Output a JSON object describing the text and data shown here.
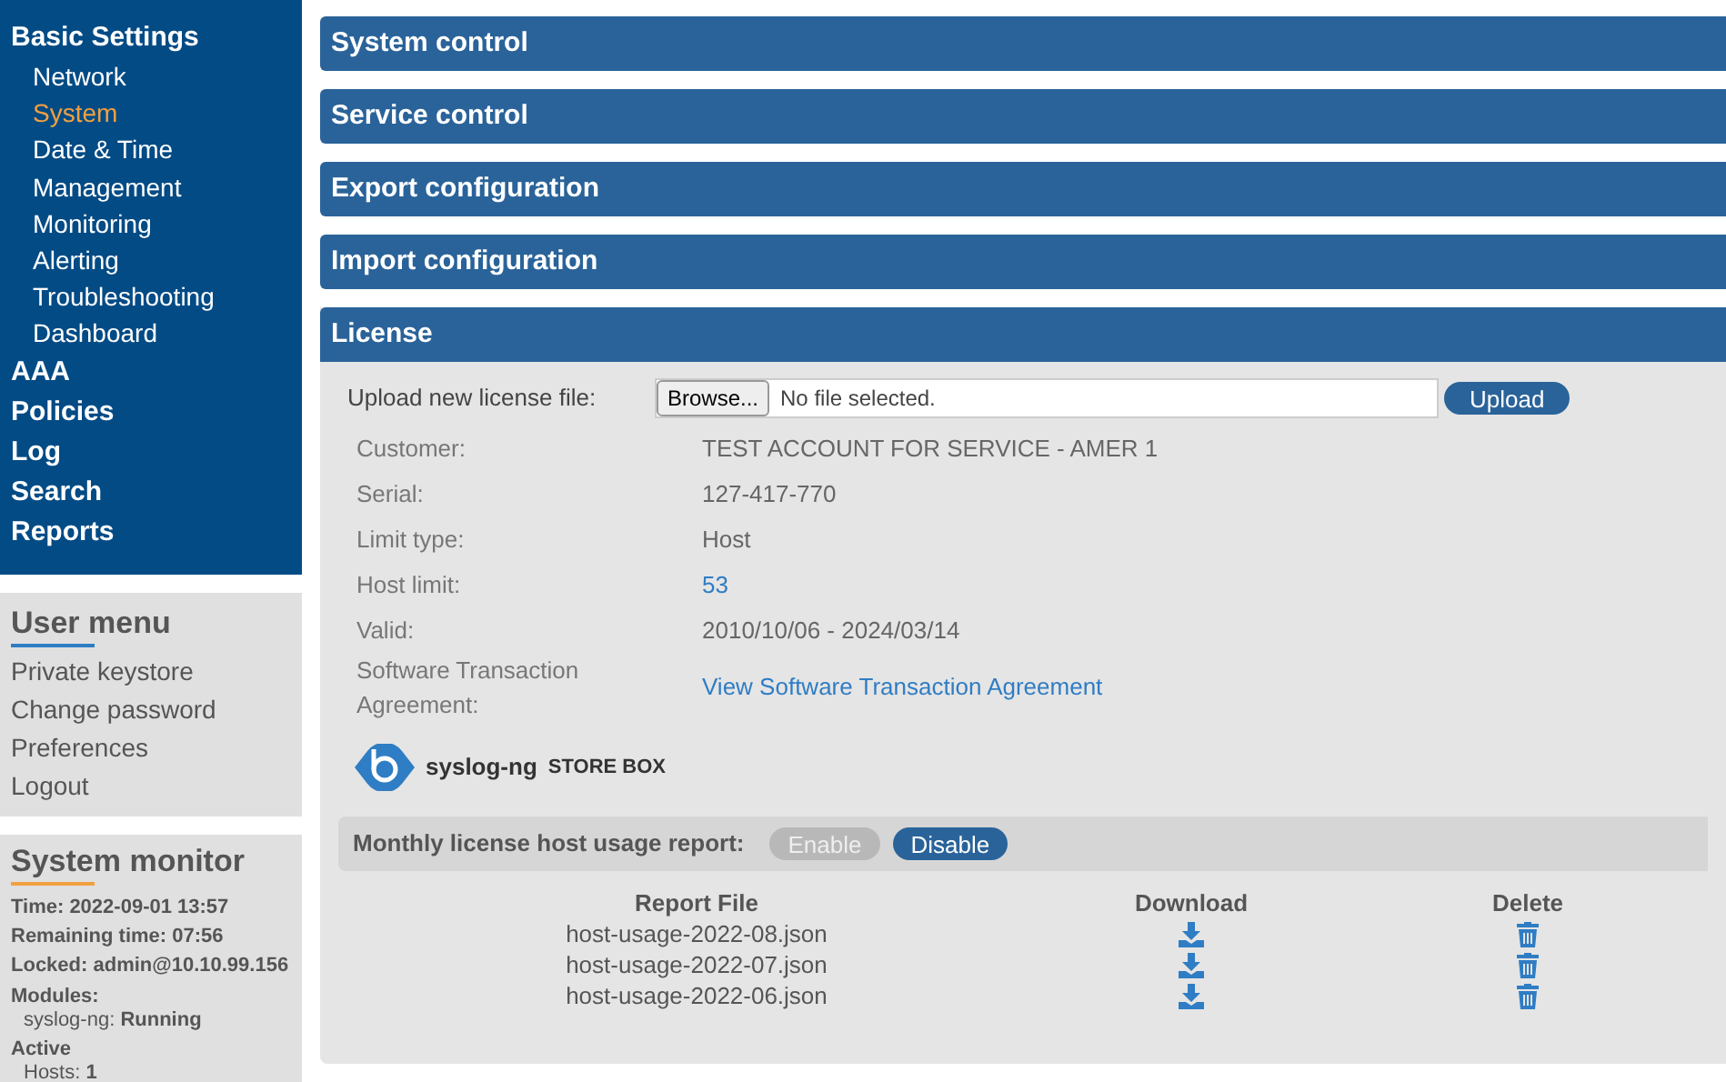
{
  "nav": [
    {
      "label": "Basic Settings",
      "selected": false,
      "children": [
        {
          "label": "Network",
          "selected": false
        },
        {
          "label": "System",
          "selected": true
        },
        {
          "label": "Date & Time",
          "selected": false
        },
        {
          "label": "Management",
          "selected": false
        },
        {
          "label": "Monitoring",
          "selected": false
        },
        {
          "label": "Alerting",
          "selected": false
        },
        {
          "label": "Troubleshooting",
          "selected": false
        },
        {
          "label": "Dashboard",
          "selected": false
        }
      ]
    },
    {
      "label": "AAA",
      "selected": false
    },
    {
      "label": "Policies",
      "selected": false
    },
    {
      "label": "Log",
      "selected": false
    },
    {
      "label": "Search",
      "selected": false
    },
    {
      "label": "Reports",
      "selected": false
    }
  ],
  "user_menu": {
    "title": "User menu",
    "items": [
      "Private keystore",
      "Change password",
      "Preferences",
      "Logout"
    ]
  },
  "system_monitor": {
    "title": "System monitor",
    "lines": [
      {
        "kind": "line",
        "text": "Time: 2022-09-01 13:57"
      },
      {
        "kind": "line",
        "text": "Remaining time: 07:56"
      },
      {
        "kind": "line",
        "text": "Locked: admin@10.10.99.156"
      },
      {
        "kind": "heading",
        "text": "Modules:"
      },
      {
        "kind": "sub",
        "text": "syslog-ng: **Running**"
      },
      {
        "kind": "heading",
        "text": "Active"
      },
      {
        "kind": "sub",
        "text": "Hosts: **1**"
      }
    ]
  },
  "sections": [
    {
      "title": "System control"
    },
    {
      "title": "Service control"
    },
    {
      "title": "Export configuration"
    },
    {
      "title": "Import configuration"
    }
  ],
  "license": {
    "title": "License",
    "upload_label": "Upload new license file:",
    "browse_button": "Browse...",
    "file_status": "No file selected.",
    "upload_button": "Upload",
    "fields": [
      {
        "label": "Customer:",
        "value": "TEST ACCOUNT FOR SERVICE - AMER 1",
        "kind": "text"
      },
      {
        "label": "Serial:",
        "value": "127-417-770",
        "kind": "text"
      },
      {
        "label": "Limit type:",
        "value": "Host",
        "kind": "text"
      },
      {
        "label": "Host limit:",
        "value": "53",
        "kind": "link"
      },
      {
        "label": "Valid:",
        "value": "2010/10/06 - 2024/03/14",
        "kind": "text"
      },
      {
        "label": "Software Transaction Agreement:",
        "value": "View Software Transaction Agreement",
        "kind": "link"
      }
    ],
    "logo": {
      "name": "syslog-ng",
      "product": "STORE BOX"
    },
    "report": {
      "label": "Monthly license host usage report:",
      "toggles": [
        {
          "label": "Enable",
          "selected": false
        },
        {
          "label": "Disable",
          "selected": true
        }
      ],
      "columns": [
        "Report File",
        "Download",
        "Delete"
      ],
      "rows": [
        "host-usage-2022-08.json",
        "host-usage-2022-07.json",
        "host-usage-2022-06.json"
      ]
    }
  }
}
